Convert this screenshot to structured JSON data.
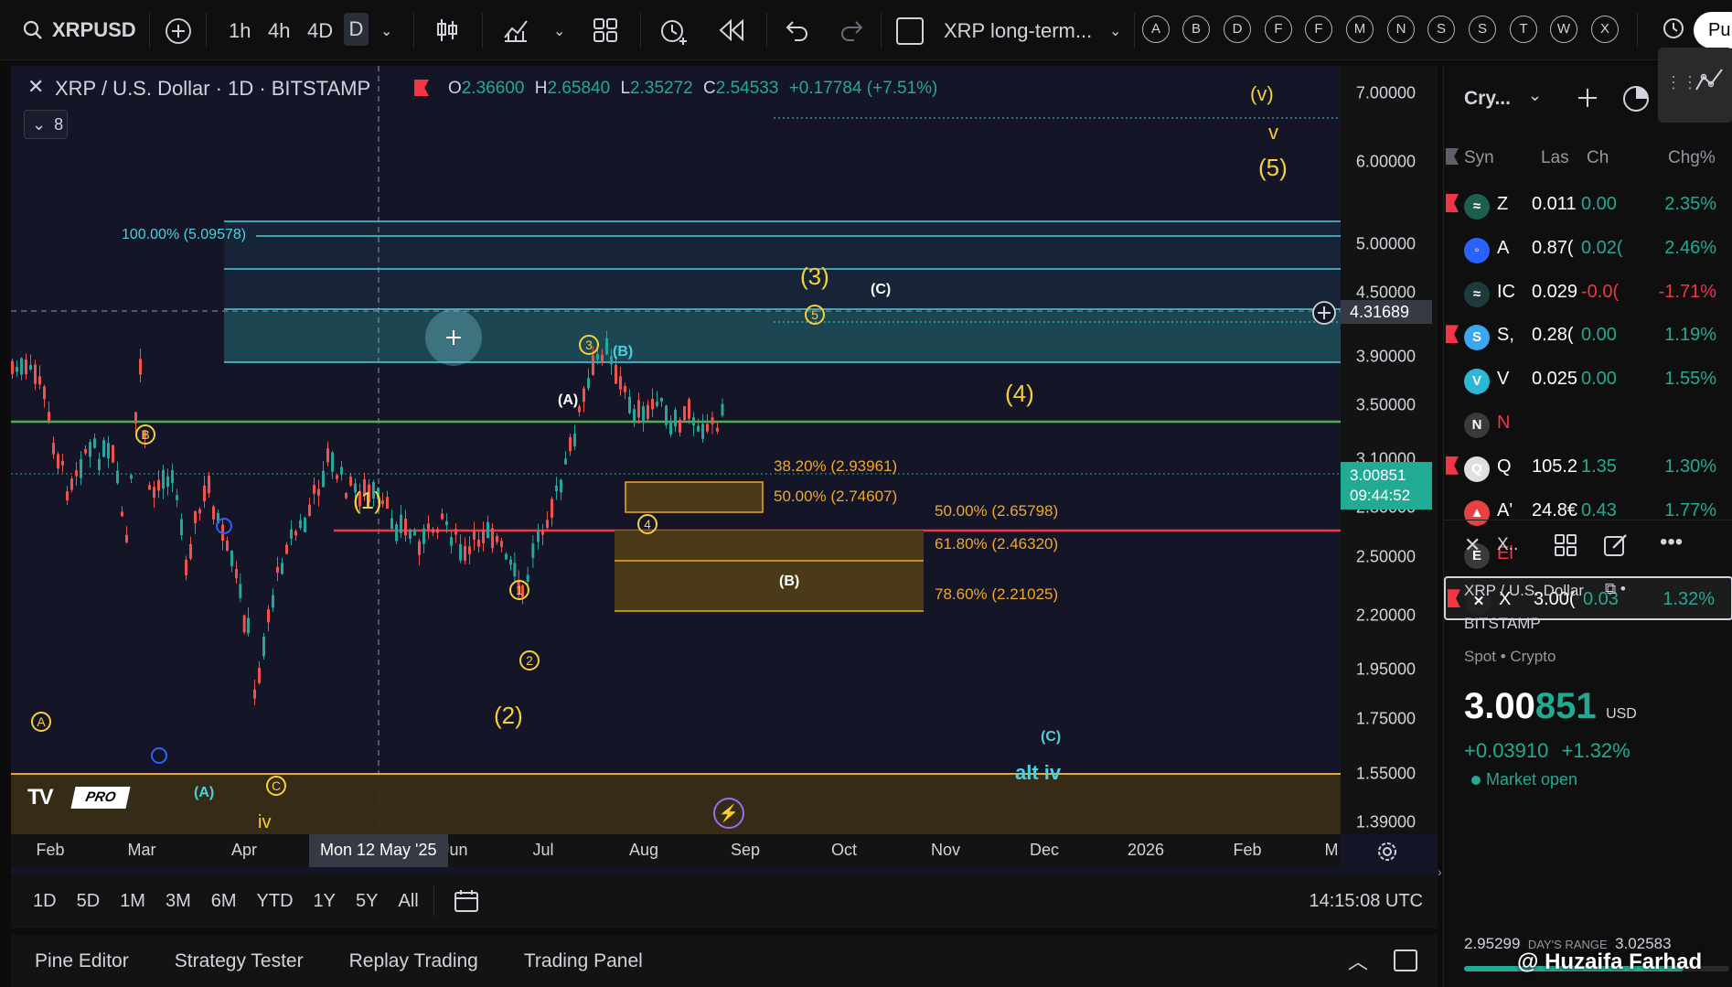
{
  "toolbar": {
    "symbol": "XRPUSD",
    "intervals": [
      "1h",
      "4h",
      "4D",
      "D"
    ],
    "active_interval": "D",
    "layout_name": "XRP long-term...",
    "letters": [
      "A",
      "B",
      "D",
      "F",
      "F",
      "M",
      "N",
      "S",
      "S",
      "T",
      "W",
      "X"
    ],
    "publish_label": "Pu"
  },
  "legend": {
    "title": "XRP / U.S. Dollar · 1D · BITSTAMP",
    "o_label": "O",
    "o": "2.36600",
    "h_label": "H",
    "h": "2.65840",
    "l_label": "L",
    "l": "2.35272",
    "c_label": "C",
    "c": "2.54533",
    "change": "+0.17784 (+7.51%)",
    "indicators_count": "8"
  },
  "price_axis": {
    "ticks": [
      "7.00000",
      "6.00000",
      "5.00000",
      "4.50000",
      "3.90000",
      "3.50000",
      "3.10000",
      "2.80000",
      "2.50000",
      "2.20000",
      "1.95000",
      "1.75000",
      "1.55000",
      "1.39000"
    ],
    "crosshair_price": "4.31689",
    "last_price": "3.00851",
    "countdown": "09:44:52"
  },
  "time_axis": {
    "ticks": [
      "Feb",
      "Mar",
      "Apr",
      "Jun",
      "Jul",
      "Aug",
      "Sep",
      "Oct",
      "Nov",
      "Dec",
      "2026",
      "Feb",
      "M"
    ],
    "crosshair_date": "Mon 12 May '25"
  },
  "annotations": {
    "fib_100": "100.00% (5.09578)",
    "fib_382": "38.20% (2.93961)",
    "fib_500a": "50.00% (2.74607)",
    "fib_500b": "50.00% (2.65798)",
    "fib_618": "61.80% (2.46320)",
    "fib_786": "78.60% (2.21025)",
    "waves": {
      "v_paren": "(v)",
      "v": "v",
      "five": "(5)",
      "three": "(3)",
      "four": "(4)",
      "one": "(1)",
      "two": "(2)",
      "c_white": "(C)",
      "a_white": "(A)",
      "b_cyan": "(B)",
      "b_box": "(B)",
      "c_cyan": "(C)",
      "a_cyan": "(A)",
      "iv": "iv",
      "alt_iv": "alt iv",
      "c3": "3",
      "c5": "5",
      "c1": "1",
      "c2": "2",
      "c4": "4",
      "cA": "A",
      "cB": "B",
      "cC": "C"
    },
    "pro_badge": "PRO"
  },
  "range_bar": {
    "ranges": [
      "1D",
      "5D",
      "1M",
      "3M",
      "6M",
      "YTD",
      "1Y",
      "5Y",
      "All"
    ],
    "clock": "14:15:08 UTC"
  },
  "bottom_tabs": [
    "Pine Editor",
    "Strategy Tester",
    "Replay Trading",
    "Trading Panel"
  ],
  "watchlist": {
    "name": "Cry...",
    "columns": [
      "Syn",
      "Las",
      "Ch",
      "Chg%"
    ],
    "rows": [
      {
        "sym": "Z",
        "last": "0.011",
        "chg": "0.00",
        "pct": "2.35%",
        "dir": "up",
        "icon_color": "#1e5e4e",
        "icon": "≈",
        "flag": true
      },
      {
        "sym": "A",
        "last": "0.87(",
        "chg": "0.02(",
        "pct": "2.46%",
        "dir": "up",
        "icon_color": "#2962ff",
        "icon": "◦",
        "flag": false
      },
      {
        "sym": "IC",
        "last": "0.029",
        "chg": "-0.0(",
        "pct": "-1.71%",
        "dir": "down",
        "icon_color": "#1e3a3a",
        "icon": "≈",
        "flag": false
      },
      {
        "sym": "S,",
        "last": "0.28(",
        "chg": "0.00",
        "pct": "1.19%",
        "dir": "up",
        "icon_color": "#3ba7f0",
        "icon": "S",
        "flag": true
      },
      {
        "sym": "V",
        "last": "0.025",
        "chg": "0.00",
        "pct": "1.55%",
        "dir": "up",
        "icon_color": "#2ab8d6",
        "icon": "V",
        "flag": false
      },
      {
        "sym": "N",
        "last": "",
        "chg": "",
        "pct": "",
        "dir": "none",
        "icon_color": "#3a3a3a",
        "icon": "N",
        "flag": false
      },
      {
        "sym": "Q",
        "last": "105.2",
        "chg": "1.35",
        "pct": "1.30%",
        "dir": "up",
        "icon_color": "#e0e0e0",
        "icon": "Q",
        "flag": true
      },
      {
        "sym": "A'",
        "last": "24.8€",
        "chg": "0.43",
        "pct": "1.77%",
        "dir": "up",
        "icon_color": "#e84142",
        "icon": "▲",
        "flag": false
      },
      {
        "sym": "El",
        "last": "",
        "chg": "",
        "pct": "",
        "dir": "none",
        "icon_color": "#3a3a3a",
        "icon": "E",
        "flag": false
      },
      {
        "sym": "X",
        "last": "3.00(",
        "chg": "0.03",
        "pct": "1.32%",
        "dir": "up",
        "icon_color": "#222222",
        "icon": "✕",
        "flag": true
      }
    ]
  },
  "details": {
    "short": "X..",
    "name": "XRP / U.S. Dollar",
    "exchange": "BITSTAMP",
    "type": "Spot • Crypto",
    "price_main": "3.00",
    "price_tail": "851",
    "currency": "USD",
    "change": "+0.03910",
    "change_pct": "+1.32%",
    "status": "Market open",
    "day_low": "2.95299",
    "day_range_label": "DAY'S RANGE",
    "day_high": "3.02583"
  },
  "watermark": "@ Huzaifa Farhad",
  "colors": {
    "up": "#22ab94",
    "down": "#f23645",
    "wave": "#f5d03a",
    "fib": "#f0a928",
    "cyan": "#4dd0e1",
    "chart_bg": "#151528"
  }
}
